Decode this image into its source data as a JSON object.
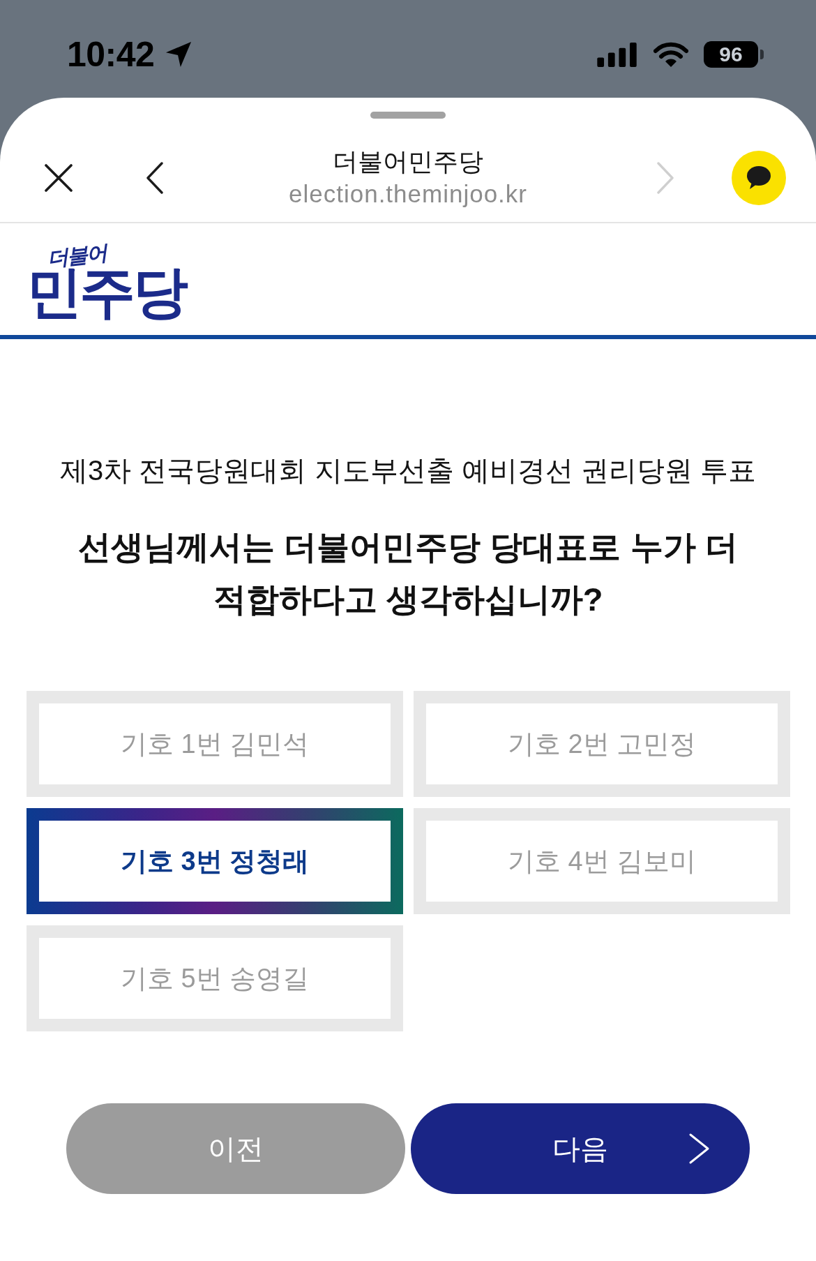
{
  "status_bar": {
    "time": "10:42",
    "battery": "96"
  },
  "browser": {
    "title": "더불어민주당",
    "url": "election.theminjoo.kr",
    "nav": [
      {
        "kind": "back",
        "disabled": false
      },
      {
        "kind": "forward",
        "disabled": true
      }
    ]
  },
  "logo": {
    "tagline": "더불어",
    "name": "민주당"
  },
  "ballot": {
    "title": "제3차 전국당원대회 지도부선출 예비경선 권리당원 투표",
    "question": "선생님께서는 더불어민주당 당대표로 누가 더 적합하다고 생각하십니까?",
    "options": [
      {
        "label": "기호 1번 김민석",
        "selected": false
      },
      {
        "label": "기호 2번 고민정",
        "selected": false
      },
      {
        "label": "기호 3번 정청래",
        "selected": true
      },
      {
        "label": "기호 4번 김보미",
        "selected": false
      },
      {
        "label": "기호 5번 송영길",
        "selected": false
      }
    ]
  },
  "buttons": [
    {
      "kind": "prev",
      "label": "이전"
    },
    {
      "kind": "next",
      "label": "다음"
    }
  ]
}
